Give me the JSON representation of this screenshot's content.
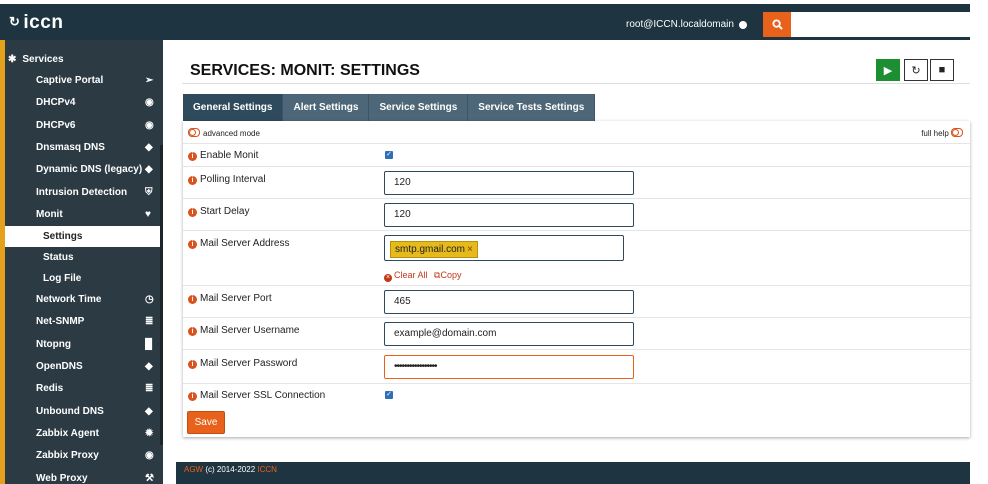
{
  "header": {
    "logo": "iccn",
    "user": "root@ICCN.localdomain",
    "search_placeholder": ""
  },
  "sidebar": {
    "section": "Services",
    "items": [
      {
        "label": "Captive Portal",
        "icon": "paper-plane-icon"
      },
      {
        "label": "DHCPv4",
        "icon": "bullseye-icon"
      },
      {
        "label": "DHCPv6",
        "icon": "bullseye-icon"
      },
      {
        "label": "Dnsmasq DNS",
        "icon": "tag-icon"
      },
      {
        "label": "Dynamic DNS (legacy)",
        "icon": "tag-icon"
      },
      {
        "label": "Intrusion Detection",
        "icon": "shield-icon"
      },
      {
        "label": "Monit",
        "icon": "heartbeat-icon"
      },
      {
        "label": "Settings",
        "sub": true,
        "active": true
      },
      {
        "label": "Status",
        "sub": true
      },
      {
        "label": "Log File",
        "sub": true
      },
      {
        "label": "Network Time",
        "icon": "clock-icon"
      },
      {
        "label": "Net-SNMP",
        "icon": "database-icon"
      },
      {
        "label": "Ntopng",
        "icon": "binoculars-icon"
      },
      {
        "label": "OpenDNS",
        "icon": "tag-icon"
      },
      {
        "label": "Redis",
        "icon": "database-icon"
      },
      {
        "label": "Unbound DNS",
        "icon": "tag-icon"
      },
      {
        "label": "Zabbix Agent",
        "icon": "cog-icon"
      },
      {
        "label": "Zabbix Proxy",
        "icon": "eye-icon"
      },
      {
        "label": "Web Proxy",
        "icon": "wrench-icon"
      }
    ]
  },
  "page": {
    "title": "SERVICES: MONIT: SETTINGS"
  },
  "tabs": [
    "General Settings",
    "Alert Settings",
    "Service Settings",
    "Service Tests Settings"
  ],
  "form": {
    "advanced_mode": "advanced mode",
    "full_help": "full help",
    "enable_monit_label": "Enable Monit",
    "enable_monit_checked": true,
    "polling_interval_label": "Polling Interval",
    "polling_interval_value": "120",
    "start_delay_label": "Start Delay",
    "start_delay_value": "120",
    "mail_server_address_label": "Mail Server Address",
    "mail_server_address_chip": "smtp.gmail.com",
    "clear_all": "Clear All",
    "copy": "Copy",
    "mail_server_port_label": "Mail Server Port",
    "mail_server_port_value": "465",
    "mail_server_username_label": "Mail Server Username",
    "mail_server_username_value": "example@domain.com",
    "mail_server_password_label": "Mail Server Password",
    "mail_server_password_value": "•••••••••••••••••",
    "mail_server_ssl_label": "Mail Server SSL Connection",
    "mail_server_ssl_checked": true,
    "save": "Save"
  },
  "footer": {
    "prefix": "AGW",
    "copyright": "(c) 2014-2022",
    "brand": "ICCN"
  },
  "colors": {
    "header_bg": "#1e3440",
    "sidebar_bg": "#2b3a43",
    "accent": "#e8621c",
    "sidebar_accent": "#e5a11b",
    "play_green": "#1d8f32",
    "tab_bg": "#4d6778",
    "tab_active_bg": "#2e4a5c",
    "chip_yellow": "#e6ba1a"
  }
}
